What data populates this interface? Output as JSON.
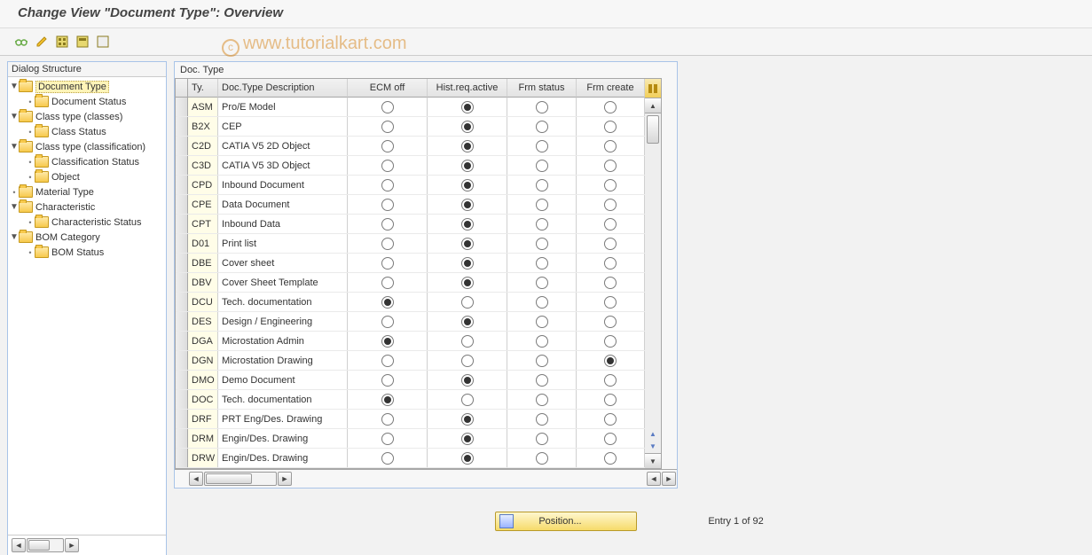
{
  "title": "Change View \"Document Type\": Overview",
  "watermark": "www.tutorialkart.com",
  "tree": {
    "header": "Dialog Structure",
    "nodes": [
      {
        "level": 0,
        "expandable": true,
        "label": "Document Type",
        "selected": true,
        "name": "node-document-type"
      },
      {
        "level": 1,
        "expandable": false,
        "label": "Document Status",
        "name": "node-document-status"
      },
      {
        "level": 0,
        "expandable": true,
        "label": "Class type (classes)",
        "name": "node-class-type-classes"
      },
      {
        "level": 1,
        "expandable": false,
        "label": "Class Status",
        "name": "node-class-status"
      },
      {
        "level": 0,
        "expandable": true,
        "label": "Class type (classification)",
        "name": "node-class-type-classification"
      },
      {
        "level": 1,
        "expandable": false,
        "label": "Classification Status",
        "name": "node-classification-status"
      },
      {
        "level": 1,
        "expandable": false,
        "label": "Object",
        "name": "node-object"
      },
      {
        "level": 0,
        "expandable": false,
        "topLevelLeaf": true,
        "label": "Material Type",
        "name": "node-material-type"
      },
      {
        "level": 0,
        "expandable": true,
        "label": "Characteristic",
        "name": "node-characteristic"
      },
      {
        "level": 1,
        "expandable": false,
        "label": "Characteristic Status",
        "name": "node-characteristic-status"
      },
      {
        "level": 0,
        "expandable": true,
        "label": "BOM Category",
        "name": "node-bom-category"
      },
      {
        "level": 1,
        "expandable": false,
        "label": "BOM Status",
        "name": "node-bom-status"
      }
    ]
  },
  "table": {
    "title": "Doc. Type",
    "columns": {
      "ty": "Ty.",
      "desc": "Doc.Type Description",
      "ecm": "ECM off",
      "hist": "Hist.req.active",
      "frmStatus": "Frm status",
      "frmCreate": "Frm create"
    },
    "rows": [
      {
        "ty": "ASM",
        "desc": "Pro/E Model",
        "ecm": false,
        "hist": true,
        "frmStatus": false,
        "frmCreate": false
      },
      {
        "ty": "B2X",
        "desc": "CEP",
        "ecm": false,
        "hist": true,
        "frmStatus": false,
        "frmCreate": false
      },
      {
        "ty": "C2D",
        "desc": "CATIA V5 2D Object",
        "ecm": false,
        "hist": true,
        "frmStatus": false,
        "frmCreate": false
      },
      {
        "ty": "C3D",
        "desc": "CATIA V5 3D Object",
        "ecm": false,
        "hist": true,
        "frmStatus": false,
        "frmCreate": false
      },
      {
        "ty": "CPD",
        "desc": "Inbound Document",
        "ecm": false,
        "hist": true,
        "frmStatus": false,
        "frmCreate": false
      },
      {
        "ty": "CPE",
        "desc": "Data Document",
        "ecm": false,
        "hist": true,
        "frmStatus": false,
        "frmCreate": false
      },
      {
        "ty": "CPT",
        "desc": "Inbound Data",
        "ecm": false,
        "hist": true,
        "frmStatus": false,
        "frmCreate": false
      },
      {
        "ty": "D01",
        "desc": "Print list",
        "ecm": false,
        "hist": true,
        "frmStatus": false,
        "frmCreate": false
      },
      {
        "ty": "DBE",
        "desc": "Cover sheet",
        "ecm": false,
        "hist": true,
        "frmStatus": false,
        "frmCreate": false
      },
      {
        "ty": "DBV",
        "desc": "Cover Sheet Template",
        "ecm": false,
        "hist": true,
        "frmStatus": false,
        "frmCreate": false
      },
      {
        "ty": "DCU",
        "desc": "Tech. documentation",
        "ecm": true,
        "hist": false,
        "frmStatus": false,
        "frmCreate": false
      },
      {
        "ty": "DES",
        "desc": "Design / Engineering",
        "ecm": false,
        "hist": true,
        "frmStatus": false,
        "frmCreate": false
      },
      {
        "ty": "DGA",
        "desc": "Microstation Admin",
        "ecm": true,
        "hist": false,
        "frmStatus": false,
        "frmCreate": false
      },
      {
        "ty": "DGN",
        "desc": "Microstation Drawing",
        "ecm": false,
        "hist": false,
        "frmStatus": false,
        "frmCreate": true
      },
      {
        "ty": "DMO",
        "desc": "Demo Document",
        "ecm": false,
        "hist": true,
        "frmStatus": false,
        "frmCreate": false
      },
      {
        "ty": "DOC",
        "desc": "Tech. documentation",
        "ecm": true,
        "hist": false,
        "frmStatus": false,
        "frmCreate": false
      },
      {
        "ty": "DRF",
        "desc": "PRT Eng/Des. Drawing",
        "ecm": false,
        "hist": true,
        "frmStatus": false,
        "frmCreate": false
      },
      {
        "ty": "DRM",
        "desc": "Engin/Des. Drawing",
        "ecm": false,
        "hist": true,
        "frmStatus": false,
        "frmCreate": false
      },
      {
        "ty": "DRW",
        "desc": "Engin/Des. Drawing",
        "ecm": false,
        "hist": true,
        "frmStatus": false,
        "frmCreate": false
      }
    ]
  },
  "positionButton": "Position...",
  "entryText": "Entry 1 of 92"
}
